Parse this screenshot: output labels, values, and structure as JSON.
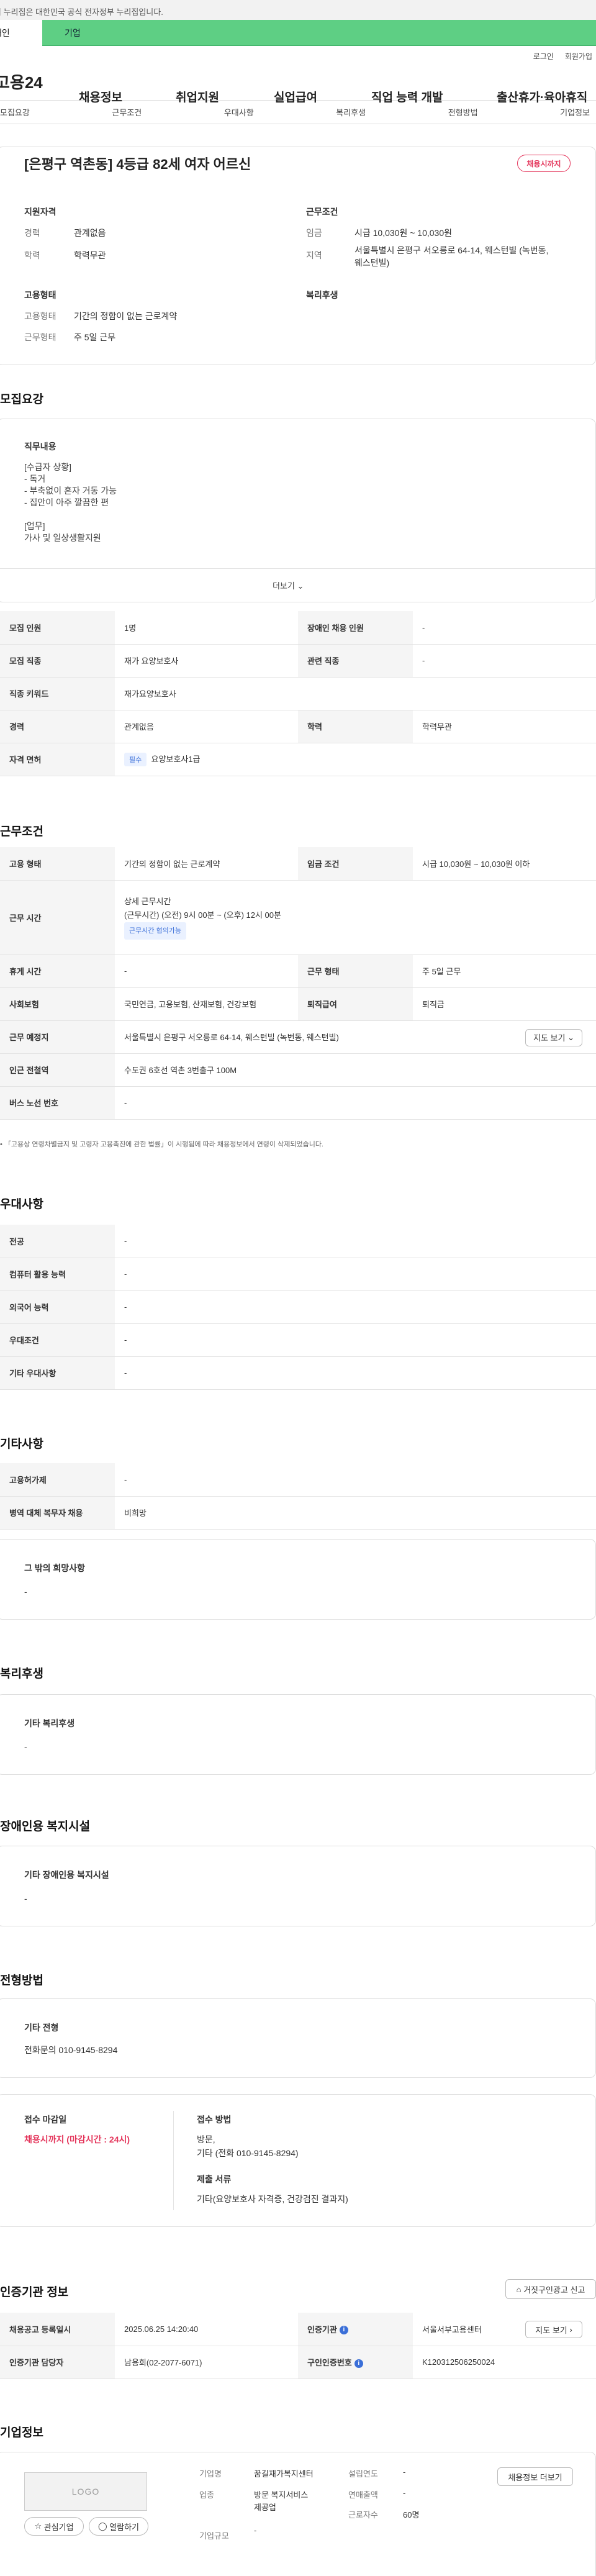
{
  "gov_banner": "이 누리집은 대한민국 공식 전자정부 누리집입니다.",
  "top_tabs": [
    "개인",
    "기업"
  ],
  "util_links": [
    "로그인",
    "회원가입"
  ],
  "logo": "고용24",
  "gnb": [
    "채용정보",
    "취업지원",
    "실업급여",
    "직업 능력 개발",
    "출산휴가·육아휴직"
  ],
  "sub_tabs": [
    "모집요강",
    "근무조건",
    "우대사항",
    "복리후생",
    "전형방법",
    "기업정보"
  ],
  "job": {
    "title": "[은평구 역촌동] 4등급 82세 여자 어르신",
    "status": "채용시까지",
    "support_h": "지원자격",
    "career_l": "경력",
    "career_v": "관계없음",
    "edu_l": "학력",
    "edu_v": "학력무관",
    "emp_h": "고용형태",
    "emp_type_l": "고용형태",
    "emp_type_v": "기간의 정함이 없는 근로계약",
    "work_form_l": "근무형태",
    "work_form_v": "주 5일 근무",
    "cond_h": "근무조건",
    "wage_l": "임금",
    "wage_v": "시급 10,030원 ~ 10,030원",
    "region_l": "지역",
    "region_v1": "서울특별시 은평구 서오릉로 64-14, 웨스턴빌 (녹번동,",
    "region_v2": "웨스턴빌)",
    "welfare_h": "복리후생"
  },
  "recruit": {
    "title": "모집요강",
    "duty_h": "직무내용",
    "duty_lines": [
      "[수급자 상황]",
      "- 독거",
      "- 부축없이 혼자 거동 가능",
      "- 집안이 아주 깔끔한 편",
      "",
      "[업무]",
      "가사 및 일상생활지원"
    ],
    "more": "더보기",
    "r1": [
      "모집 인원",
      "1명",
      "장애인 채용 인원",
      "-"
    ],
    "r2": [
      "모집 직종",
      "재가 요양보호사",
      "관련 직종",
      "-"
    ],
    "r3": [
      "직종 키워드",
      "재가요양보호사"
    ],
    "r4": [
      "경력",
      "관계없음",
      "학력",
      "학력무관"
    ],
    "r5_label": "자격 면허",
    "r5_tag": "필수",
    "r5_val": "요양보호사1급"
  },
  "work": {
    "title": "근무조건",
    "r1": [
      "고용 형태",
      "기간의 정함이 없는 근로계약",
      "임금 조건",
      "시급 10,030원 ~ 10,030원 이하"
    ],
    "r2_label": "근무 시간",
    "r2_h": "상세 근무시간",
    "r2_v": "(근무시간) (오전) 9시 00분 ~ (오후) 12시 00분",
    "r2_tag": "근무시간 협의가능",
    "r3": [
      "휴게 시간",
      "-",
      "근무 형태",
      "주 5일 근무"
    ],
    "r4": [
      "사회보험",
      "국민연금, 고용보험, 산재보험, 건강보험",
      "퇴직급여",
      "퇴직금"
    ],
    "r5": [
      "근무 예정지",
      "서울특별시 은평구 서오릉로 64-14, 웨스턴빌 (녹번동, 웨스턴빌)"
    ],
    "map_btn": "지도 보기",
    "r6": [
      "인근 전철역",
      "수도권 6호선 역촌 3번출구 100M"
    ],
    "r7": [
      "버스 노선 번호",
      "-"
    ],
    "note": "「고용상 연령차별금지 및 고령자 고용촉진에 관한 법률」이 시행됨에 따라 채용정보에서 연령이 삭제되었습니다."
  },
  "pref": {
    "title": "우대사항",
    "rows": [
      [
        "전공",
        "-"
      ],
      [
        "컴퓨터 활용 능력",
        "-"
      ],
      [
        "외국어 능력",
        "-"
      ],
      [
        "우대조건",
        "-"
      ],
      [
        "기타 우대사항",
        "-"
      ]
    ]
  },
  "etc": {
    "title": "기타사항",
    "rows": [
      [
        "고용허가제",
        "-"
      ],
      [
        "병역 대체 복무자 채용",
        "비희망"
      ]
    ],
    "other_h": "그 밖의 희망사항",
    "other_v": "-"
  },
  "benefit": {
    "title": "복리후생",
    "h": "기타 복리후생",
    "v": "-"
  },
  "disab": {
    "title": "장애인용 복지시설",
    "h": "기타 장애인용 복지시설",
    "v": "-"
  },
  "select": {
    "title": "전형방법",
    "h": "기타 전형",
    "v": "전화문의 010-9145-8294",
    "deadline_h": "접수 마감일",
    "deadline_v": "채용시까지 (마감시간 : 24시)",
    "method_h": "접수 방법",
    "method_v1": "방문,",
    "method_v2": "기타 (전화 010-9145-8294)",
    "docs_h": "제출 서류",
    "docs_v": "기타(요양보호사 자격증, 건강검진 결과지)"
  },
  "cert": {
    "title": "인증기관 정보",
    "report_btn": "거짓구인광고 신고",
    "r1": [
      "채용공고 등록일시",
      "2025.06.25 14:20:40",
      "인증기관",
      "서울서부고용센터"
    ],
    "map_btn": "지도 보기",
    "r2": [
      "인증기관 담당자",
      "남용희(02-2077-6071)",
      "구인인증번호",
      "K120312506250024"
    ]
  },
  "company": {
    "title": "기업정보",
    "logo": "LOGO",
    "fav_btn": "관심기업",
    "review_btn": "열람하기",
    "name_l": "기업명",
    "name_v": "꿈길재가복지센터",
    "industry_l": "업종",
    "industry_v1": "방문 복지서비스",
    "industry_v2": "제공업",
    "size_l": "기업규모",
    "size_v": "-",
    "est_l": "설립연도",
    "est_v": "-",
    "sales_l": "연매출액",
    "sales_v": "-",
    "emp_l": "근로자수",
    "emp_v": "60명",
    "jobs_btn": "채용정보 더보기"
  },
  "colors": {
    "green": "#5ecf84",
    "red": "#e4345a",
    "blue": "#3b6fd8"
  }
}
